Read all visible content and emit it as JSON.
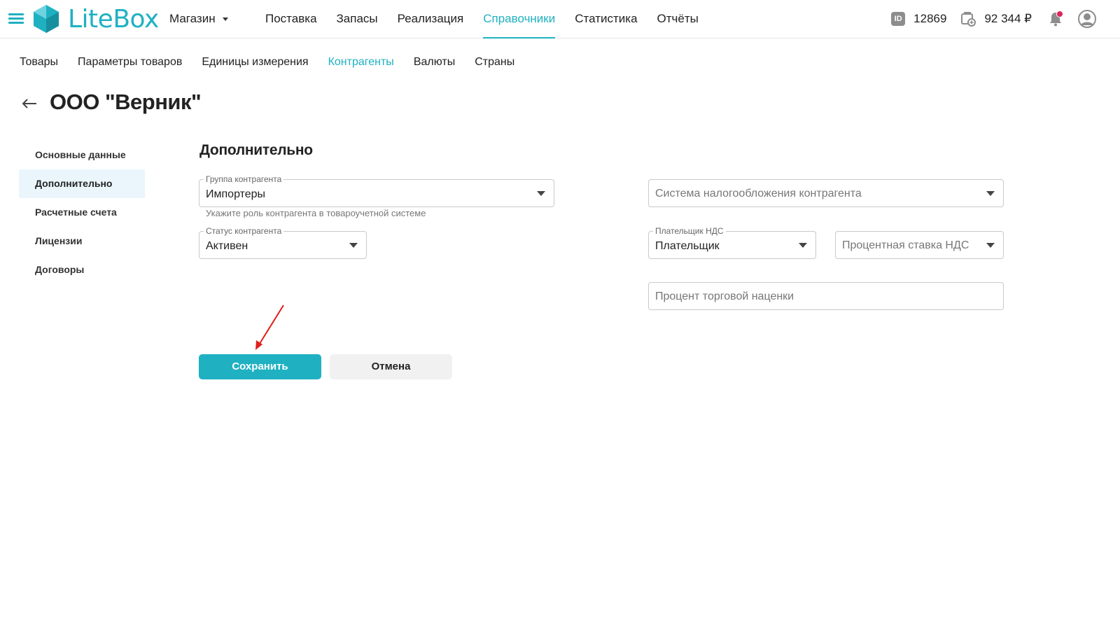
{
  "app": {
    "logo_text": "LiteBox",
    "store_label": "Магазин",
    "accent_color": "#1fb1c2"
  },
  "main_nav": [
    {
      "label": "Поставка",
      "active": false
    },
    {
      "label": "Запасы",
      "active": false
    },
    {
      "label": "Реализация",
      "active": false
    },
    {
      "label": "Справочники",
      "active": true
    },
    {
      "label": "Статистика",
      "active": false
    },
    {
      "label": "Отчёты",
      "active": false
    }
  ],
  "header_tools": {
    "id_badge": "ID",
    "id_value": "12869",
    "balance": "92 344 ₽",
    "icons": [
      "id-icon",
      "wallet-icon",
      "bell-icon",
      "user-avatar-icon"
    ],
    "notification_dot_color": "#e0245e"
  },
  "sub_nav": [
    {
      "label": "Товары",
      "active": false
    },
    {
      "label": "Параметры товаров",
      "active": false
    },
    {
      "label": "Единицы измерения",
      "active": false
    },
    {
      "label": "Контрагенты",
      "active": true
    },
    {
      "label": "Валюты",
      "active": false
    },
    {
      "label": "Страны",
      "active": false
    }
  ],
  "page": {
    "title": "ООО \"Верник\""
  },
  "side_menu": [
    {
      "label": "Основные данные",
      "active": false
    },
    {
      "label": "Дополнительно",
      "active": true
    },
    {
      "label": "Расчетные счета",
      "active": false
    },
    {
      "label": "Лицензии",
      "active": false
    },
    {
      "label": "Договоры",
      "active": false
    }
  ],
  "form": {
    "section_title": "Дополнительно",
    "group": {
      "label": "Группа контрагента",
      "value": "Импортеры",
      "helper": "Укажите роль контрагента в товароучетной системе"
    },
    "status": {
      "label": "Статус контрагента",
      "value": "Активен"
    },
    "tax_system": {
      "placeholder": "Система налогообложения контрагента"
    },
    "vat_payer": {
      "label": "Плательщик НДС",
      "value": "Плательщик"
    },
    "vat_rate": {
      "placeholder": "Процентная ставка НДС"
    },
    "markup": {
      "placeholder": "Процент торговой наценки"
    },
    "save_label": "Сохранить",
    "cancel_label": "Отмена"
  },
  "annotation": {
    "arrow_color": "#e0201b"
  }
}
